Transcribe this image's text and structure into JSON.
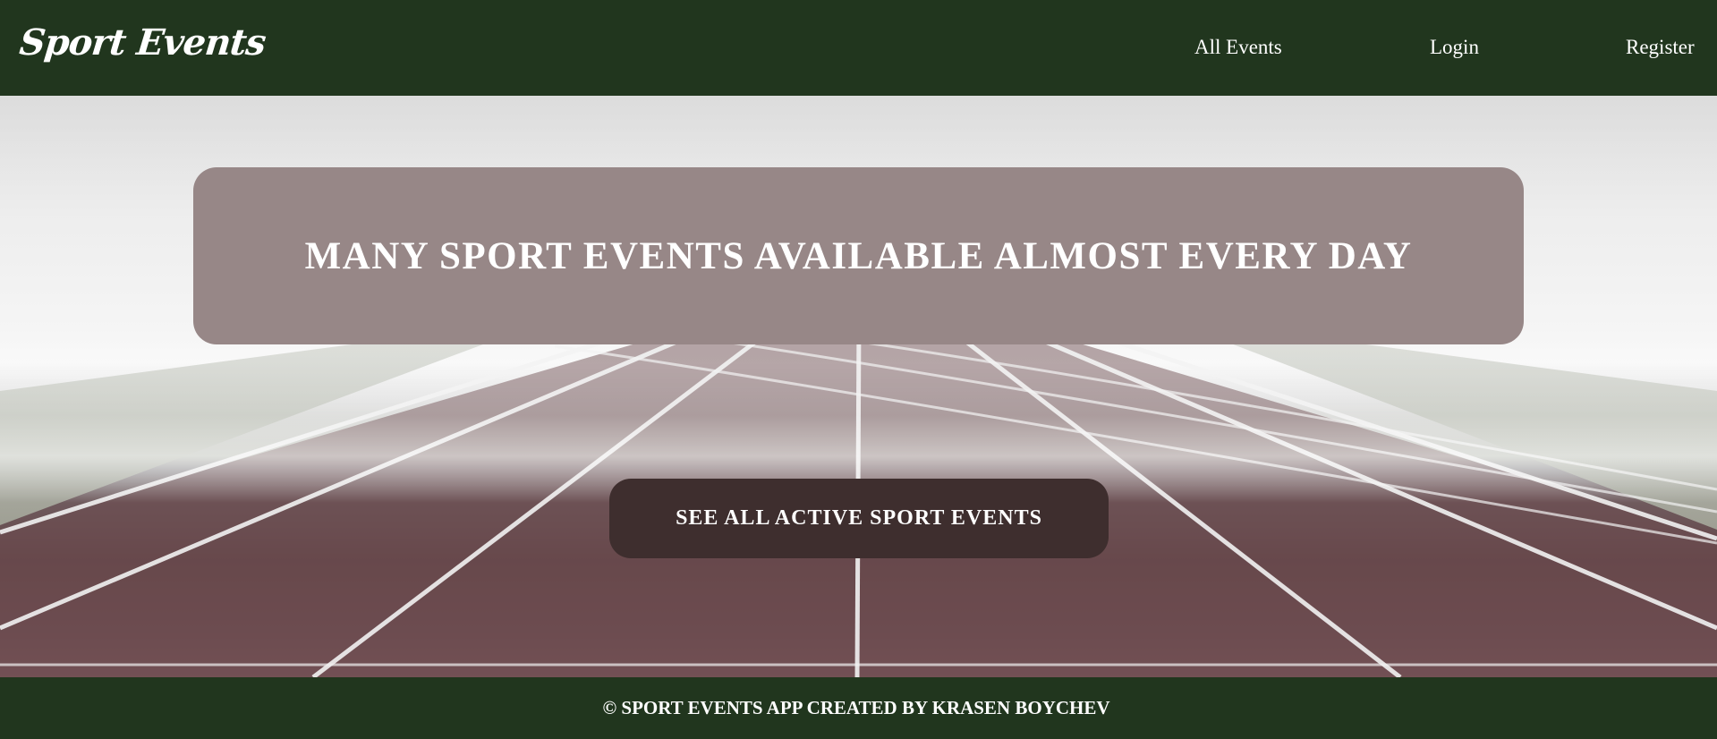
{
  "header": {
    "logo": "Sport Events",
    "nav": {
      "all_events": "All Events",
      "login": "Login",
      "register": "Register"
    }
  },
  "hero": {
    "banner_title": "MANY SPORT EVENTS AVAILABLE ALMOST EVERY DAY",
    "cta_label": "SEE ALL ACTIVE SPORT EVENTS"
  },
  "footer": {
    "text": "© SPORT EVENTS APP CREATED BY KRASEN BOYCHEV"
  },
  "colors": {
    "header_bg": "#21361e",
    "banner_bg": "#978787",
    "cta_bg": "#3e2e2e",
    "track": "#6e4e52"
  }
}
